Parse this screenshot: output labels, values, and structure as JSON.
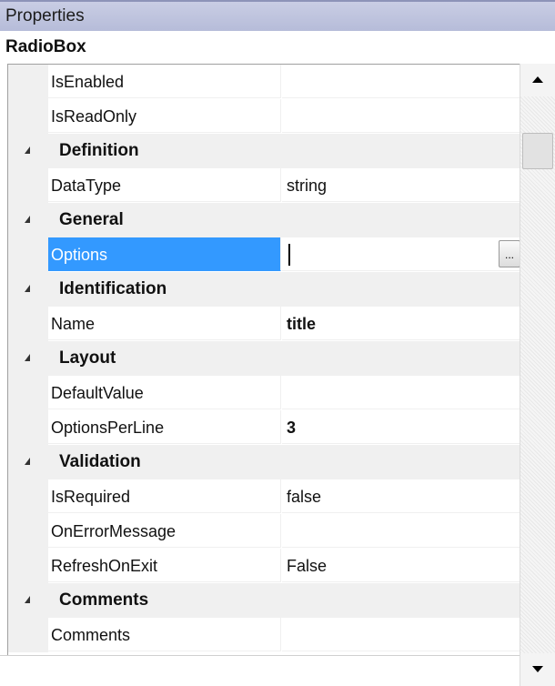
{
  "panel": {
    "title": "Properties",
    "object_name": "RadioBox"
  },
  "rows": {
    "isenabled": {
      "name": "IsEnabled",
      "value": ""
    },
    "isreadonly": {
      "name": "IsReadOnly",
      "value": ""
    },
    "cat_definition": "Definition",
    "datatype": {
      "name": "DataType",
      "value": "string"
    },
    "cat_general": "General",
    "options": {
      "name": "Options",
      "value": "",
      "button": "..."
    },
    "cat_identification": "Identification",
    "name": {
      "name": "Name",
      "value": "title"
    },
    "cat_layout": "Layout",
    "defaultvalue": {
      "name": "DefaultValue",
      "value": ""
    },
    "optionsperline": {
      "name": "OptionsPerLine",
      "value": "3"
    },
    "cat_validation": "Validation",
    "isrequired": {
      "name": "IsRequired",
      "value": "false"
    },
    "onerrormessage": {
      "name": "OnErrorMessage",
      "value": ""
    },
    "refreshonexit": {
      "name": "RefreshOnExit",
      "value": "False"
    },
    "cat_comments": "Comments",
    "comments": {
      "name": "Comments",
      "value": ""
    }
  },
  "colors": {
    "selection": "#3399ff",
    "category_bg": "#f0f0f0",
    "titlebar": "#b6bcd9"
  },
  "icons": {
    "collapse": "collapse-triangle-icon",
    "scroll_up": "scroll-up-arrow-icon",
    "scroll_down": "scroll-down-arrow-icon"
  }
}
